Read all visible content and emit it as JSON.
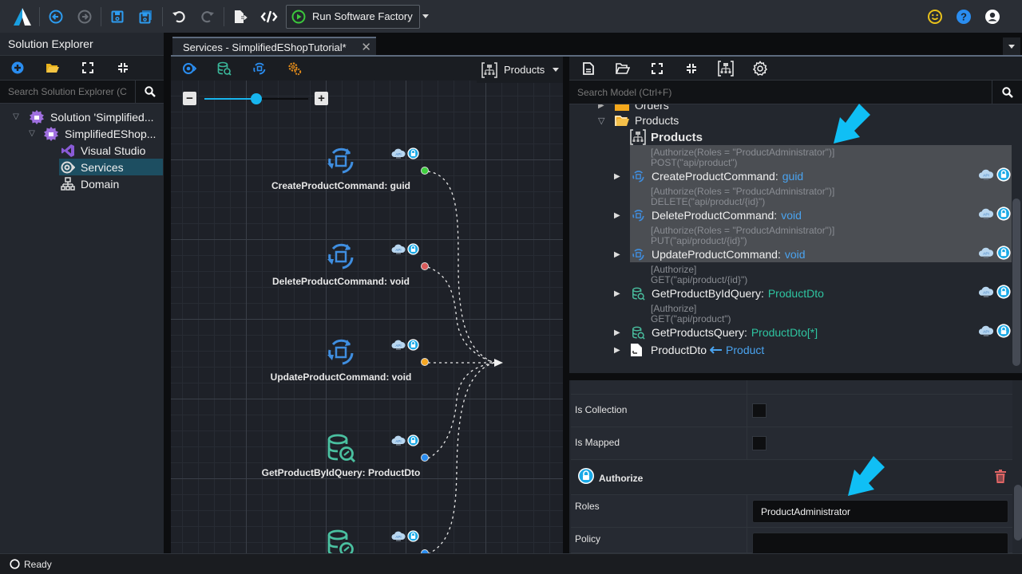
{
  "toolbar": {
    "run_label": "Run Software Factory",
    "buttons": [
      "back",
      "forward",
      "save",
      "save-all",
      "undo",
      "redo",
      "export",
      "code"
    ]
  },
  "header_right": [
    "feedback",
    "help",
    "account"
  ],
  "solution_explorer": {
    "title": "Solution Explorer",
    "search_placeholder": "Search Solution Explorer (Ctrl",
    "tree": [
      {
        "label": "Solution 'Simplified...",
        "level": 0,
        "icon": "solution-icon",
        "expanded": true
      },
      {
        "label": "SimplifiedEShop...",
        "level": 1,
        "icon": "application-icon",
        "expanded": true
      },
      {
        "label": "Visual Studio",
        "level": 2,
        "icon": "visual-studio-icon"
      },
      {
        "label": "Services",
        "level": 2,
        "icon": "services-icon",
        "selected": true
      },
      {
        "label": "Domain",
        "level": 2,
        "icon": "domain-icon"
      }
    ]
  },
  "document_tab": {
    "title": "Services - SimplifiedEShopTutorial*"
  },
  "diagram": {
    "selector_label": "Products",
    "zoom_level": 0.5,
    "nodes": [
      {
        "label": "CreateProductCommand: guid",
        "kind": "command",
        "port_color": "#3fcf3f"
      },
      {
        "label": "DeleteProductCommand: void",
        "kind": "command",
        "port_color": "#d95b5b"
      },
      {
        "label": "UpdateProductCommand: void",
        "kind": "command",
        "port_color": "#f5a623"
      },
      {
        "label": "GetProductByIdQuery: ProductDto",
        "kind": "query",
        "port_color": "#2a8df0"
      },
      {
        "label": "",
        "kind": "query",
        "port_color": "#2a8df0"
      }
    ]
  },
  "model": {
    "search_placeholder": "Search Model (Ctrl+F)",
    "folders": [
      {
        "label": "Orders",
        "expanded": false
      },
      {
        "label": "Products",
        "expanded": true
      }
    ],
    "diagram_item": "Products",
    "items": [
      {
        "ann1": "[Authorize(Roles = \"ProductAdministrator\")]",
        "ann2": "POST(\"api/product\")",
        "name": "CreateProductCommand",
        "type": "guid",
        "kind": "command",
        "selected": true
      },
      {
        "ann1": "[Authorize(Roles = \"ProductAdministrator\")]",
        "ann2": "DELETE(\"api/product/{id}\")",
        "name": "DeleteProductCommand",
        "type": "void",
        "kind": "command",
        "selected": true
      },
      {
        "ann1": "[Authorize(Roles = \"ProductAdministrator\")]",
        "ann2": "PUT(\"api/product/{id}\")",
        "name": "UpdateProductCommand",
        "type": "void",
        "kind": "command",
        "selected": true
      },
      {
        "ann1": "[Authorize]",
        "ann2": "GET(\"api/product/{id}\")",
        "name": "GetProductByIdQuery",
        "type": "ProductDto",
        "kind": "query",
        "selected": false
      },
      {
        "ann1": "[Authorize]",
        "ann2": "GET(\"api/product\")",
        "name": "GetProductsQuery",
        "type": "ProductDto[*]",
        "kind": "query",
        "selected": false
      }
    ],
    "dto": {
      "name": "ProductDto",
      "mapped_from": "Product"
    },
    "colon": ":"
  },
  "properties": {
    "is_collection_label": "Is Collection",
    "is_collection": false,
    "is_mapped_label": "Is Mapped",
    "is_mapped": false,
    "stereotype_title": "Authorize",
    "roles_label": "Roles",
    "roles_value": "ProductAdministrator",
    "policy_label": "Policy",
    "policy_value": ""
  },
  "status": {
    "text": "Ready"
  },
  "colors": {
    "accent": "#17b5ee",
    "type_blue": "#4aa3ef",
    "type_green": "#2ec4a0",
    "delete_red": "#e06565"
  }
}
